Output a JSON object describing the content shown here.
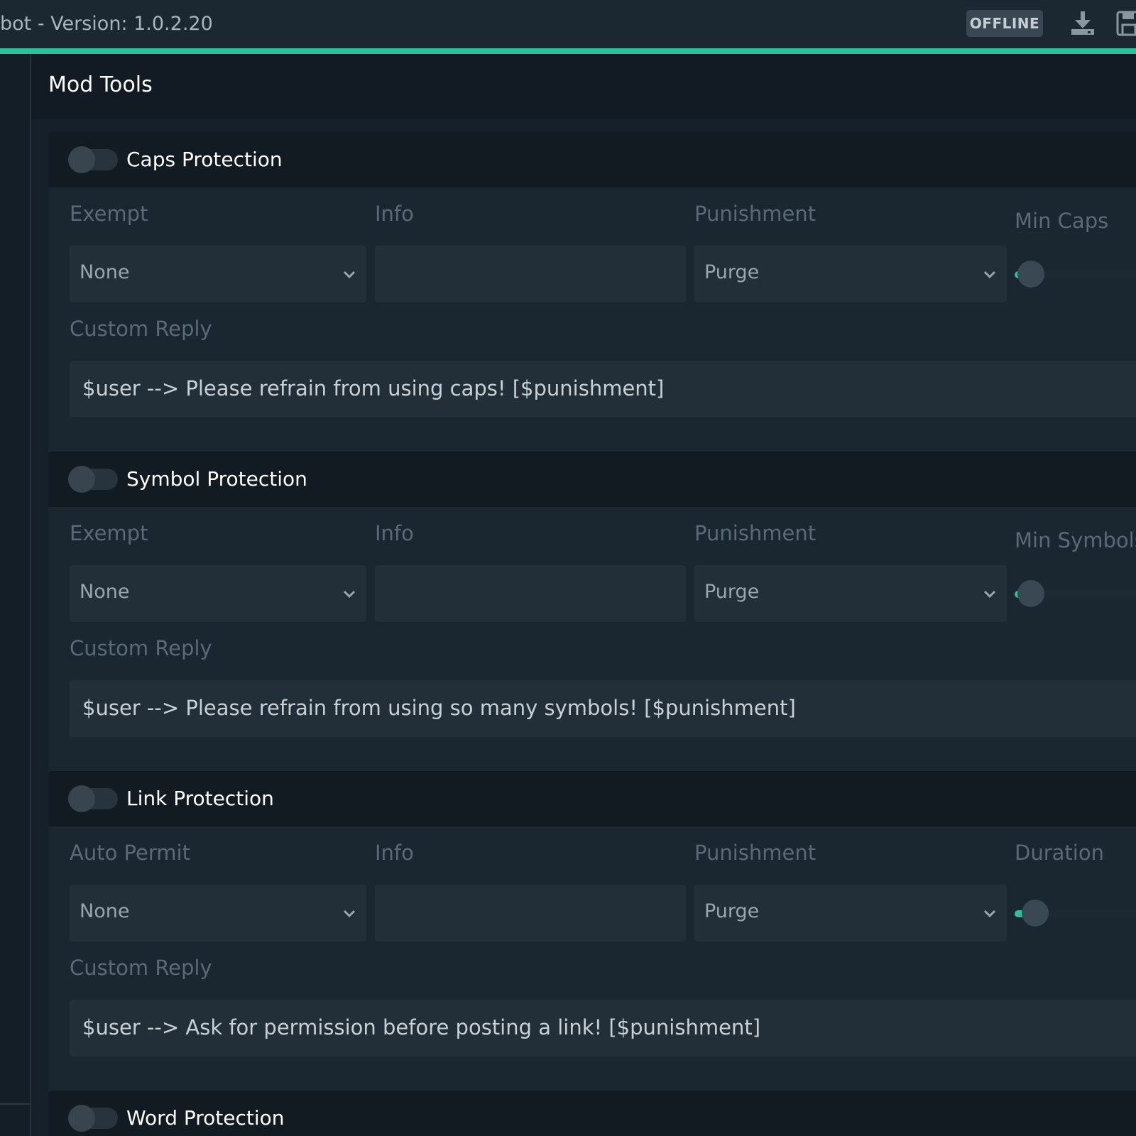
{
  "window": {
    "title": "bot - Version: 1.0.2.20",
    "status_badge": "OFFLINE",
    "accent_color": "#2fbf9a"
  },
  "icons": [
    "download-icon",
    "save-icon",
    "chevron-down-icon"
  ],
  "page": {
    "title": "Mod Tools"
  },
  "sections": [
    {
      "title": "Caps Protection",
      "enabled": false,
      "col1_label": "Exempt",
      "col1_value": "None",
      "info_label": "Info",
      "info_value": "",
      "punishment_label": "Punishment",
      "punishment_value": "Purge",
      "slider_label": "Min Caps",
      "slider_fraction": 0.02,
      "reply_label": "Custom Reply",
      "reply_value": "$user --> Please refrain from using caps! [$punishment]"
    },
    {
      "title": "Symbol Protection",
      "enabled": false,
      "col1_label": "Exempt",
      "col1_value": "None",
      "info_label": "Info",
      "info_value": "",
      "punishment_label": "Punishment",
      "punishment_value": "Purge",
      "slider_label": "Min Symbols",
      "slider_fraction": 0.02,
      "reply_label": "Custom Reply",
      "reply_value": "$user --> Please refrain from using so many symbols! [$punishment]"
    },
    {
      "title": "Link Protection",
      "enabled": false,
      "col1_label": "Auto Permit",
      "col1_value": "None",
      "info_label": "Info",
      "info_value": "",
      "punishment_label": "Punishment",
      "punishment_value": "Purge",
      "slider_label": "Duration",
      "slider_fraction": 0.05,
      "reply_label": "Custom Reply",
      "reply_value": "$user --> Ask for permission before posting a link! [$punishment]"
    },
    {
      "title": "Word Protection",
      "enabled": false
    }
  ]
}
